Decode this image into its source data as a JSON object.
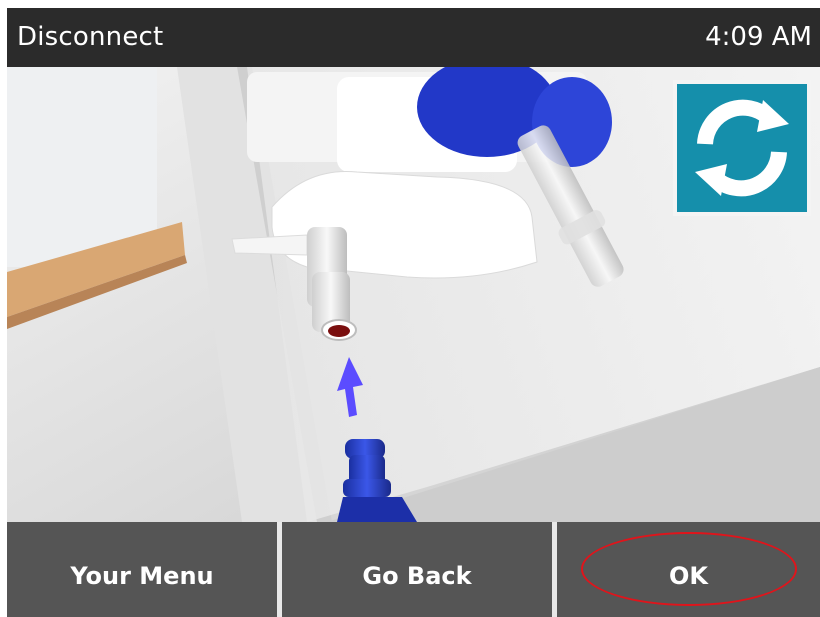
{
  "header": {
    "title": "Disconnect",
    "time": "4:09 AM"
  },
  "illustration": {
    "description_icon": "connector-disconnect-illustration",
    "arrow_icon": "up-arrow-icon",
    "arrow_color": "#5b4cff"
  },
  "refresh_button": {
    "icon": "refresh-icon",
    "color": "#158fab"
  },
  "footer": {
    "menu_label": "Your Menu",
    "back_label": "Go Back",
    "ok_label": "OK"
  },
  "highlight": {
    "target": "ok-button",
    "color": "#e0141b"
  }
}
